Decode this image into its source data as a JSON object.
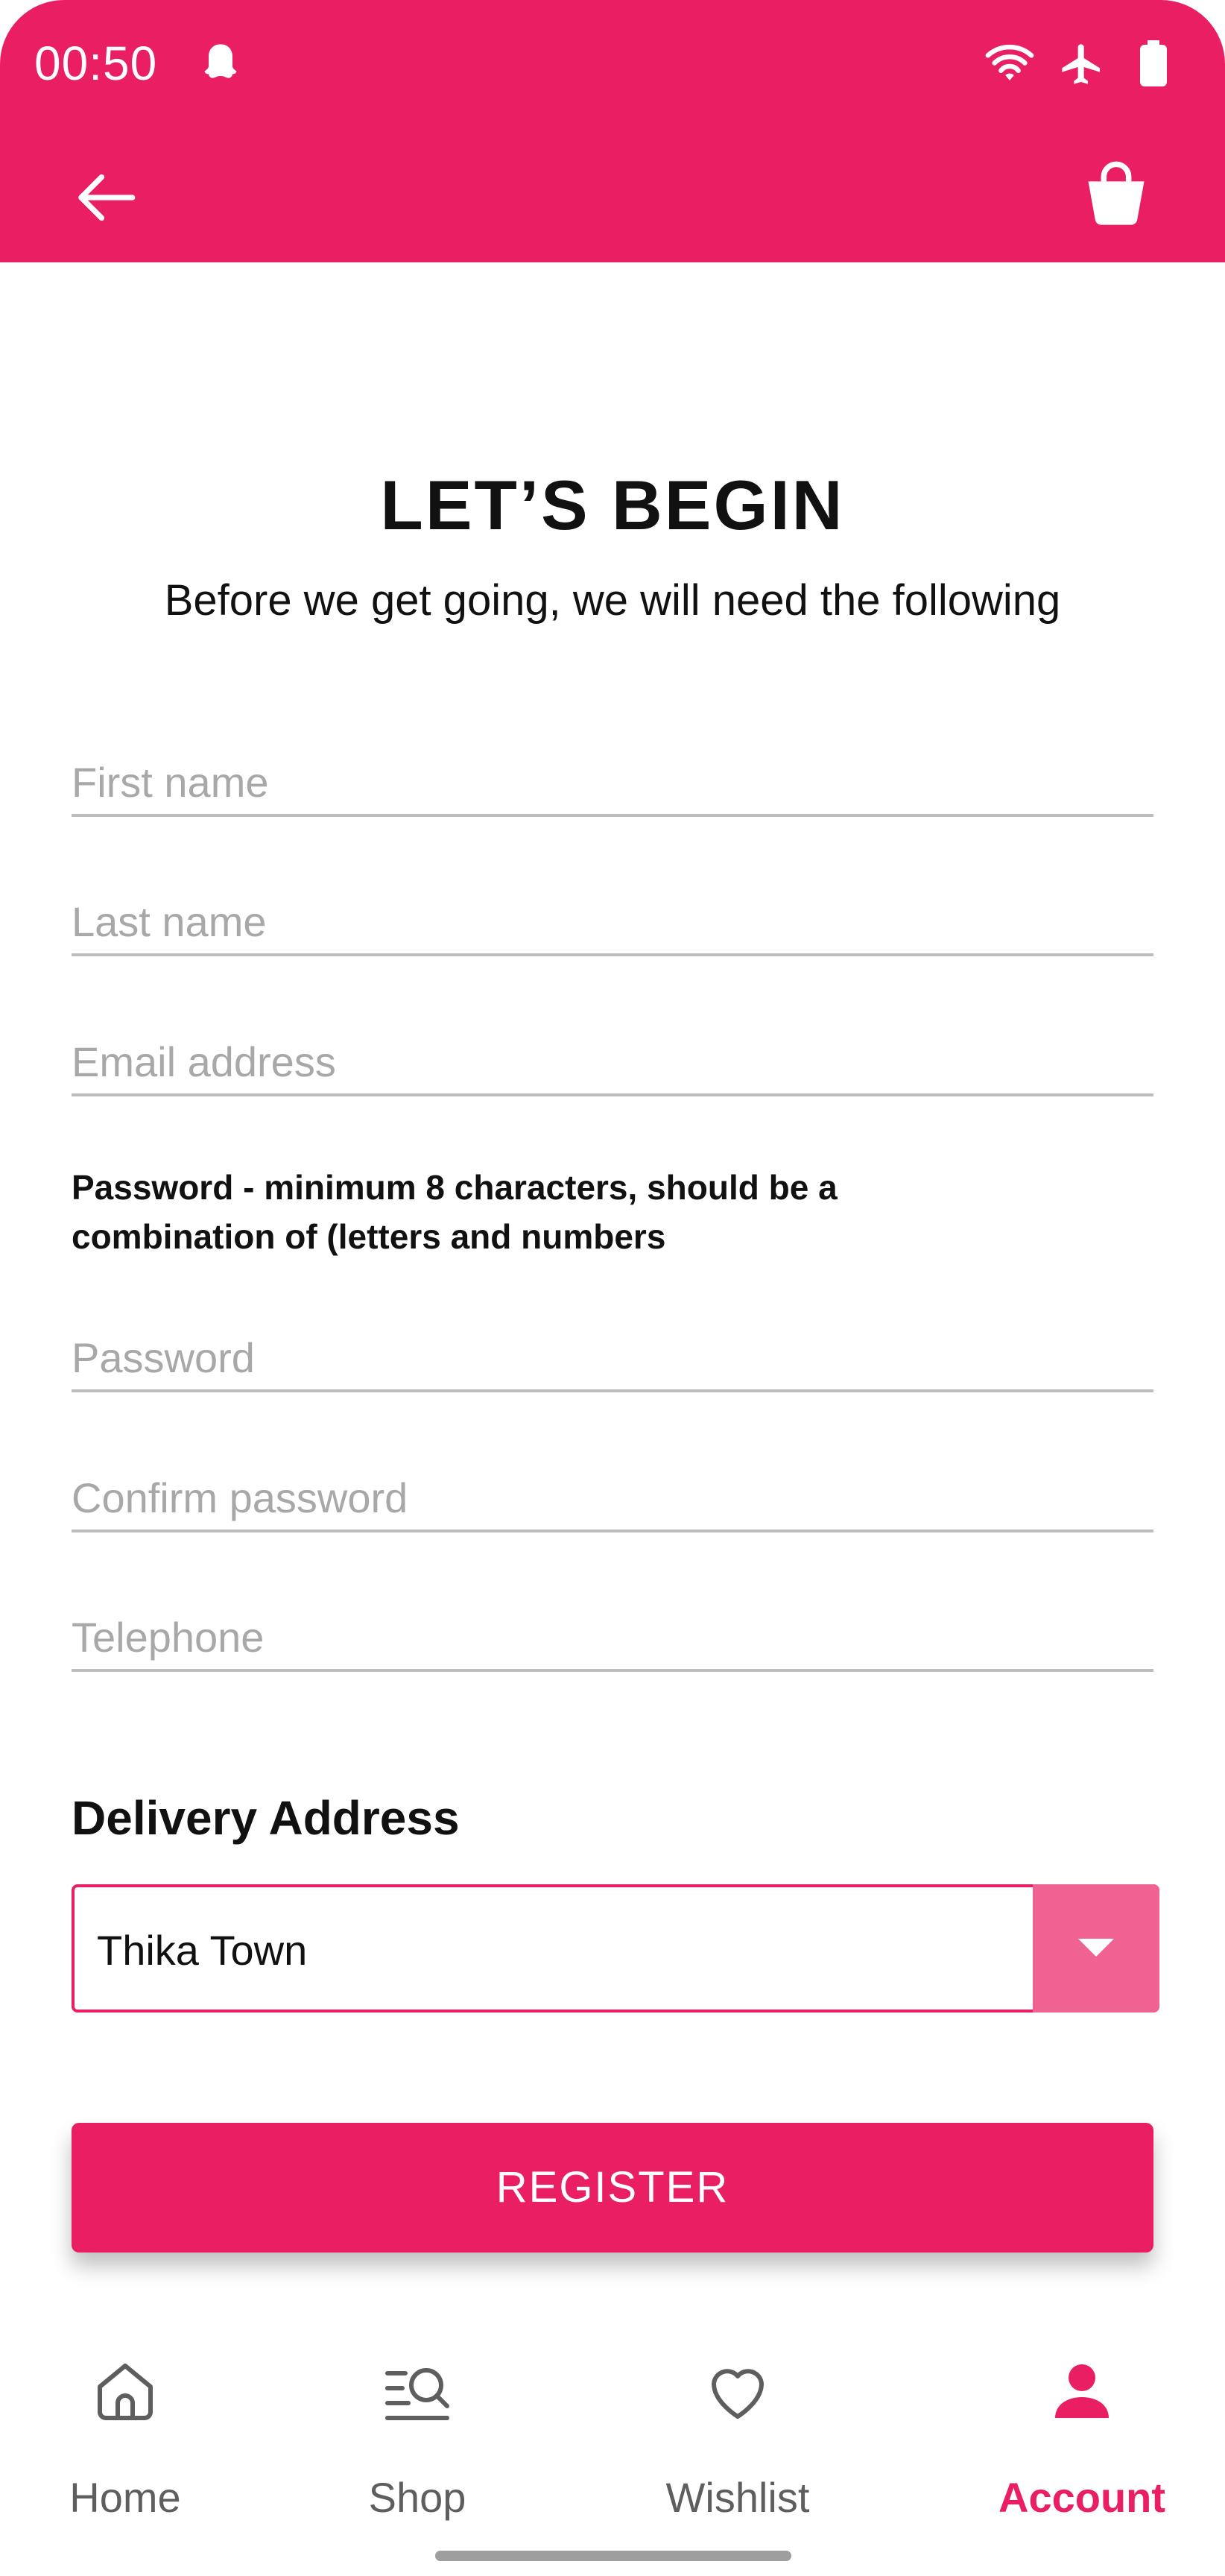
{
  "status_bar": {
    "time": "00:50",
    "icons": [
      "ghost-icon",
      "wifi-icon",
      "airplane-icon",
      "battery-icon"
    ]
  },
  "header": {
    "back_icon": "arrow-left-icon",
    "cart_icon": "shopping-bag-icon"
  },
  "page": {
    "title": "LET’S BEGIN",
    "subtitle": "Before we get going, we will need the following"
  },
  "form": {
    "first_name": {
      "placeholder": "First name",
      "value": ""
    },
    "last_name": {
      "placeholder": "Last name",
      "value": ""
    },
    "email": {
      "placeholder": "Email address",
      "value": ""
    },
    "password_hint_line1": "Password - minimum 8 characters, should be a",
    "password_hint_line2": "combination of (letters and numbers",
    "password": {
      "placeholder": "Password",
      "value": ""
    },
    "confirm_password": {
      "placeholder": "Confirm password",
      "value": ""
    },
    "telephone": {
      "placeholder": "Telephone",
      "value": ""
    },
    "delivery_title": "Delivery Address",
    "delivery_selected": "Thika Town",
    "register_label": "REGISTER"
  },
  "bottom_nav": {
    "items": [
      {
        "label": "Home",
        "icon": "home-icon",
        "active": false
      },
      {
        "label": "Shop",
        "icon": "shop-search-icon",
        "active": false
      },
      {
        "label": "Wishlist",
        "icon": "heart-icon",
        "active": false
      },
      {
        "label": "Account",
        "icon": "account-icon",
        "active": true
      }
    ]
  },
  "colors": {
    "primary": "#E91E63",
    "primary_light": "#F06292",
    "text": "#111111",
    "placeholder": "#A8A8A8",
    "divider": "#BDBDBD"
  }
}
